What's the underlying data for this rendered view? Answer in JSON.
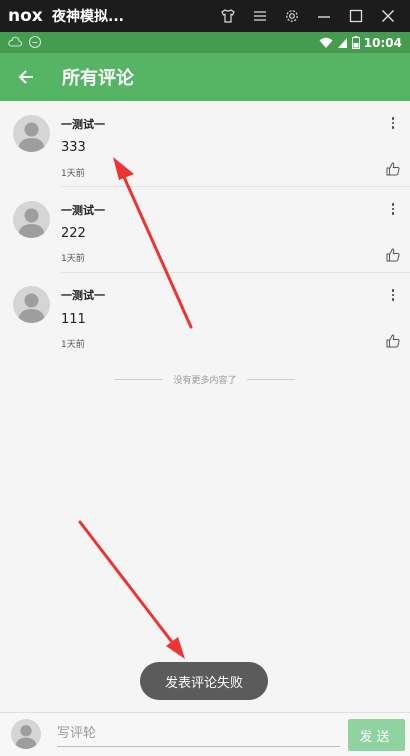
{
  "emulator": {
    "logo": "nox",
    "title": "夜神模拟...",
    "icons": [
      "shirt-icon",
      "menu-icon",
      "gear-icon",
      "minimize-icon",
      "maximize-icon",
      "close-icon"
    ]
  },
  "status_bar": {
    "time": "10:04",
    "icons": [
      "cloud-icon",
      "nox-icon",
      "wifi-icon",
      "signal-icon",
      "battery-icon"
    ]
  },
  "app_bar": {
    "title": "所有评论",
    "back_icon": "arrow-left-icon"
  },
  "comments": [
    {
      "author": "一测试一",
      "text": "333",
      "time": "1天前"
    },
    {
      "author": "一测试一",
      "text": "222",
      "time": "1天前"
    },
    {
      "author": "一测试一",
      "text": "111",
      "time": "1天前"
    }
  ],
  "no_more": "没有更多内容了",
  "toast": "发表评论失败",
  "bottom_bar": {
    "input_placeholder": "写评轮",
    "send_label": "发送"
  },
  "colors": {
    "status_bar": "#459b4f",
    "app_bar": "#56b465",
    "send_button": "#8fd3a0",
    "toast": "#5b5b5b",
    "annotation_arrow": "#ee3333"
  }
}
